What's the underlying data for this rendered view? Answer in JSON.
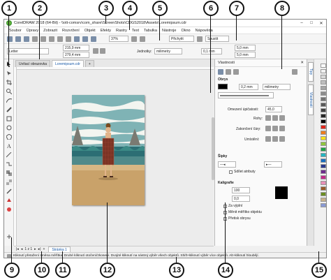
{
  "callouts": {
    "c1": "1",
    "c2": "2",
    "c3": "3",
    "c4": "4",
    "c5": "5",
    "c6": "6",
    "c7": "7",
    "c8": "8",
    "c9": "9",
    "c10": "10",
    "c11": "11",
    "c12": "12",
    "c13": "13",
    "c14": "14",
    "c15": "15"
  },
  "window": {
    "title": "CorelDRAW 2018 (64-Bit) - \\\\ott-comsrv\\com_share\\ScreenShots\\CDGS2018\\Assets\\Loremipsum.cdr",
    "min": "–",
    "max": "□",
    "close": "✕"
  },
  "menu": [
    "Soubor",
    "Úpravy",
    "Zobrazit",
    "Rozvržení",
    "Objekt",
    "Efekty",
    "Rastry",
    "Text",
    "Tabulka",
    "Nástroje",
    "Okno",
    "Nápověda"
  ],
  "toolbar": {
    "zoom": "37%",
    "snap": "Přichytit",
    "launch": "Spustit"
  },
  "propbar": {
    "paper": "Letter",
    "width": "215,9 mm",
    "height": "279,4 mm",
    "units_label": "Jednotky:",
    "units": "milimetry",
    "nudge": "0,1 mm",
    "dup_x": "5,0 mm",
    "dup_y": "5,0 mm"
  },
  "doctabs": {
    "welcome": "Uvítací obrazovka",
    "doc": "Loremipsum.cdr",
    "add": "+"
  },
  "docker": {
    "title": "Vlastnosti",
    "outline": "Obrys",
    "outline_width": "0,2 mm",
    "outline_units": "milimetry",
    "miter_label": "Omezení úpičatosti:",
    "miter_value": "45,0",
    "corners": "Rohy:",
    "caps": "Zakončení čáry:",
    "position": "Umístění:",
    "arrows": "Šipky",
    "share_attr": "Sdílet atributy",
    "calligraphy": "Kaligrafie",
    "stretch": "100",
    "angle": "0,0",
    "behind_fill": "Za výplní",
    "scale_image": "Měnit měřítko objektu",
    "overprint": "Přetisk obrysu"
  },
  "vtabs": {
    "tips": "Tipy",
    "props": "Vlastnosti"
  },
  "palette": {
    "colors": [
      "#ffffff",
      "#f2f2f2",
      "#d9d9d9",
      "#bfbfbf",
      "#a6a6a6",
      "#8c8c8c",
      "#737373",
      "#595959",
      "#404040",
      "#262626",
      "#000000",
      "#e0261b",
      "#f07c1e",
      "#fbe11a",
      "#8fc73e",
      "#1fa24a",
      "#25b5c2",
      "#1a6fbf",
      "#2b3a8f",
      "#6d2d8c",
      "#c32b8a",
      "#e88fb7",
      "#9a5b2a",
      "#6b8e23",
      "#c9b28b",
      "#8a9ad5"
    ]
  },
  "pagenav": {
    "first": "|◂",
    "prev": "◂",
    "count": "1 z 1",
    "next": "▸",
    "last": "▸|",
    "add": "+",
    "tab": "Stránka 1"
  },
  "status": {
    "hint": "Kliknutí přetažení změna měřítka. Druhé kliknutí otočení/zkosení. Dvojité kliknutí na nástroj výběr všech objektů. Shift+kliknutí výběr více objektů. Alt+kliknutí hloubějí."
  },
  "icons": {
    "pick": "pick-tool-icon",
    "logo": "coreldraw-logo-icon"
  }
}
